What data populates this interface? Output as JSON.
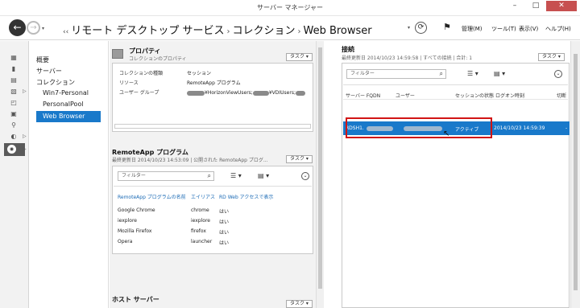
{
  "window": {
    "title": "サーバー マネージャー",
    "min": "–",
    "max": "□",
    "close": "✕"
  },
  "nav": {
    "back": "←",
    "forward": "→",
    "dropdown": "▾",
    "prefix": "‹‹",
    "breadcrumb": [
      "リモート デスクトップ サービス",
      "コレクション",
      "Web Browser"
    ],
    "separator": "›",
    "refresh": "⟳",
    "refresh_dropdown": "▾",
    "flag": "⚑",
    "menus": [
      "管理(M)",
      "ツール(T)",
      "表示(V)",
      "ヘルプ(H)"
    ]
  },
  "rail": {
    "icons": [
      "dashboard-icon",
      "local-server-icon",
      "all-servers-icon",
      "file-storage-icon",
      "iis-icon",
      "print-icon",
      "ad-icon",
      "rds-icon"
    ],
    "glyphs": [
      "▦",
      "▮",
      "▤",
      "▧",
      "◰",
      "▣",
      "⚲",
      "◐"
    ],
    "arrow": "▷",
    "selected_glyph": "◉"
  },
  "tree": {
    "overview": "概要",
    "servers": "サーバー",
    "collections": "コレクション",
    "items": [
      "Win7-Personal",
      "PersonalPool",
      "Web Browser"
    ]
  },
  "properties": {
    "title": "プロパティ",
    "subtitle": "コレクションのプロパティ",
    "task": "タスク ▾",
    "rows": [
      {
        "key": "コレクションの種類",
        "value": "セッション"
      },
      {
        "key": "リソース",
        "value": "RemoteApp プログラム"
      },
      {
        "key": "ユーザー グループ",
        "value": "¥HorizonViewUsers;",
        "value2": "¥VDIUsers;"
      }
    ]
  },
  "remoteapp": {
    "title": "RemoteApp プログラム",
    "subtitle": "最終更新日 2014/10/23 14:53:09 | 公開された RemoteApp プログ...",
    "task": "タスク ▾",
    "filter_placeholder": "フィルター",
    "search_icon": "⌕",
    "columns": [
      "RemoteApp プログラムの名前",
      "エイリアス",
      "RD Web アクセスで表示"
    ],
    "rows": [
      [
        "Google Chrome",
        "chrome",
        "はい"
      ],
      [
        "iexplore",
        "iexplore",
        "はい"
      ],
      [
        "Mozilla Firefox",
        "firefox",
        "はい"
      ],
      [
        "Opera",
        "launcher",
        "はい"
      ]
    ]
  },
  "hosts": {
    "title": "ホスト サーバー",
    "task": "タスク ▾"
  },
  "connections": {
    "title": "接続",
    "subtitle": "最終更新日 2014/10/23 14:59:58 | すべての接続 | 合計: 1",
    "task": "タスク ▾",
    "filter_placeholder": "フィルター",
    "search_icon": "⌕",
    "columns": [
      "サーバー FQDN",
      "ユーザー",
      "セッションの状態",
      "ログオン時刻",
      "切断"
    ],
    "row": {
      "server": "RDSH1.",
      "state": "アクティブ",
      "logon": "2014/10/23 14:59:39",
      "disconnect": "-"
    }
  },
  "controls": {
    "list": "☰ ▾",
    "grid": "▤ ▾",
    "expand": "⌄",
    "cursor": "↖"
  }
}
